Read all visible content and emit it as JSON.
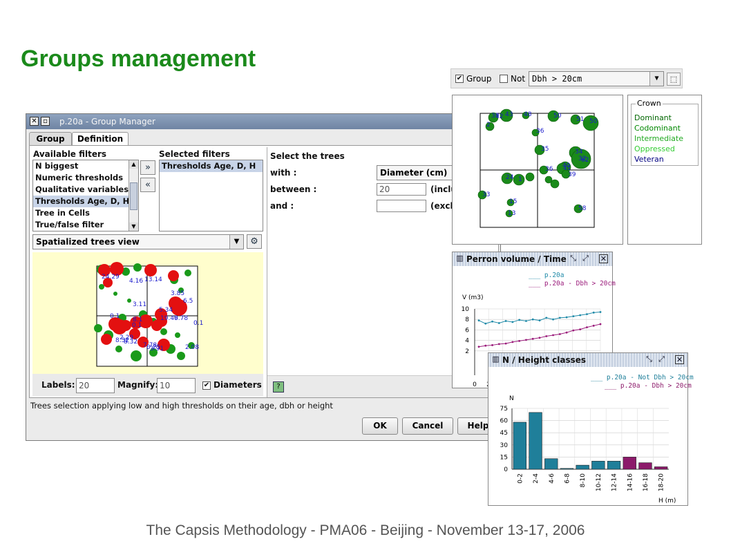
{
  "slide": {
    "title": "Groups management",
    "footer": "The Capsis Methodology - PMA06 - Beijing - November 13-17, 2006"
  },
  "dialog": {
    "title": "p.20a - Group Manager",
    "tabs": [
      {
        "label": "Group"
      },
      {
        "label": "Definition",
        "selected": true
      }
    ],
    "available_filters_label": "Available filters",
    "available_filters": [
      "N biggest",
      "Numeric thresholds",
      "Qualitative variables",
      "Thresholds Age, D, H",
      "Tree in Cells",
      "True/false filter"
    ],
    "available_selected_index": 3,
    "selected_filters_label": "Selected filters",
    "selected_filters": [
      "Thresholds Age, D, H"
    ],
    "add_icon": "double-chevron-right",
    "remove_icon": "double-chevron-left",
    "view_selector": "Spatialized trees view",
    "select_trees_label": "Select the trees",
    "with_label": "with :",
    "with_value": "Diameter (cm)",
    "between_label": "between :",
    "between_value": "20",
    "between_suffix": "(inclu",
    "and_label": "and :",
    "and_value": "",
    "and_suffix": "(exclu",
    "labels_label": "Labels:",
    "labels_value": "20",
    "magnify_label": "Magnify:",
    "magnify_value": "10",
    "diameters_label": "Diameters",
    "diameters_checked": true,
    "status": "Trees selection applying low and high thresholds on their age, dbh or height",
    "ok": "OK",
    "cancel": "Cancel",
    "help": "Help",
    "tree_labels": [
      "24.29",
      "4.16",
      "13.14",
      "3.85",
      "6.5",
      "3.11",
      "5.34",
      "0.1",
      "9.78",
      "8.1",
      "19.46",
      "0.1",
      "0.1",
      "8.32",
      "7.78",
      "0.25",
      "3.91",
      "2.08",
      "2.29",
      "8.32"
    ],
    "colors": {
      "selected_tree": "#e31010",
      "other_tree": "#1a9a1a",
      "labels": "#1a1acc"
    }
  },
  "group_bar": {
    "group_label": "Group",
    "group_checked": true,
    "not_label": "Not",
    "not_checked": false,
    "filter": "Dbh > 20cm"
  },
  "map": {
    "labels": [
      "39",
      "42",
      "43",
      "48",
      "50",
      "51",
      "50",
      "2",
      "36",
      "35",
      "34",
      "32",
      "62",
      "24",
      "1",
      "36",
      "40",
      "41",
      "39",
      "33",
      "15",
      "13",
      "58"
    ]
  },
  "crown_legend": {
    "title": "Crown",
    "items": [
      {
        "label": "Dominant",
        "color": "#006600"
      },
      {
        "label": "Codominant",
        "color": "#008800"
      },
      {
        "label": "Intermediate",
        "color": "#22aa22"
      },
      {
        "label": "Oppressed",
        "color": "#33cc33"
      },
      {
        "label": "Veteran",
        "color": "#000080"
      }
    ]
  },
  "volume_window": {
    "title": "Perron volume / Time",
    "series_labels": [
      "p.20a",
      "p.20a - Dbh > 20cm"
    ],
    "ylabel": "V (m3)",
    "yticks": [
      "10",
      "8",
      "6",
      "4",
      "2"
    ],
    "xticks": [
      "0",
      "2"
    ],
    "colors": {
      "p.20a": "#1f8aa8",
      "filtered": "#9a1a7a"
    },
    "chart_data": {
      "type": "line",
      "ylabel": "V (m3)",
      "ylim": [
        0,
        10
      ],
      "series": [
        {
          "name": "p.20a",
          "values": [
            7.8,
            7.2,
            7.6,
            7.3,
            7.7,
            7.5,
            7.9,
            7.7,
            8.0,
            7.8,
            8.3,
            8.0,
            8.3,
            8.4,
            8.6,
            8.8,
            9.0,
            9.3,
            9.4
          ]
        },
        {
          "name": "p.20a - Dbh > 20cm",
          "values": [
            2.8,
            3.0,
            3.1,
            3.3,
            3.4,
            3.7,
            3.9,
            4.1,
            4.3,
            4.5,
            4.8,
            5.0,
            5.2,
            5.5,
            5.9,
            6.1,
            6.5,
            6.8,
            7.1
          ]
        }
      ]
    }
  },
  "height_window": {
    "title": "N / Height classes",
    "series_labels": [
      "p.20a - Not Dbh > 20cm",
      "p.20a - Dbh > 20cm"
    ],
    "ylabel": "N",
    "xlabel": "H (m)",
    "colors": {
      "not_filtered": "#1f7f9a",
      "filtered": "#8c1a6a"
    },
    "chart_data": {
      "type": "bar",
      "categories": [
        "0-2",
        "2-4",
        "4-6",
        "6-8",
        "8-10",
        "10-12",
        "12-14",
        "14-16",
        "16-18",
        "18-20"
      ],
      "series": [
        {
          "name": "p.20a - Not Dbh > 20cm",
          "values": [
            58,
            70,
            13,
            1,
            5,
            10,
            10,
            1,
            0,
            0
          ]
        },
        {
          "name": "p.20a - Dbh > 20cm",
          "values": [
            0,
            0,
            0,
            0,
            0,
            0,
            0,
            15,
            8,
            3
          ]
        }
      ],
      "ylim": [
        0,
        75
      ],
      "yticks": [
        0,
        15,
        30,
        45,
        60,
        75
      ],
      "ylabel": "N",
      "xlabel": "H (m)"
    }
  }
}
